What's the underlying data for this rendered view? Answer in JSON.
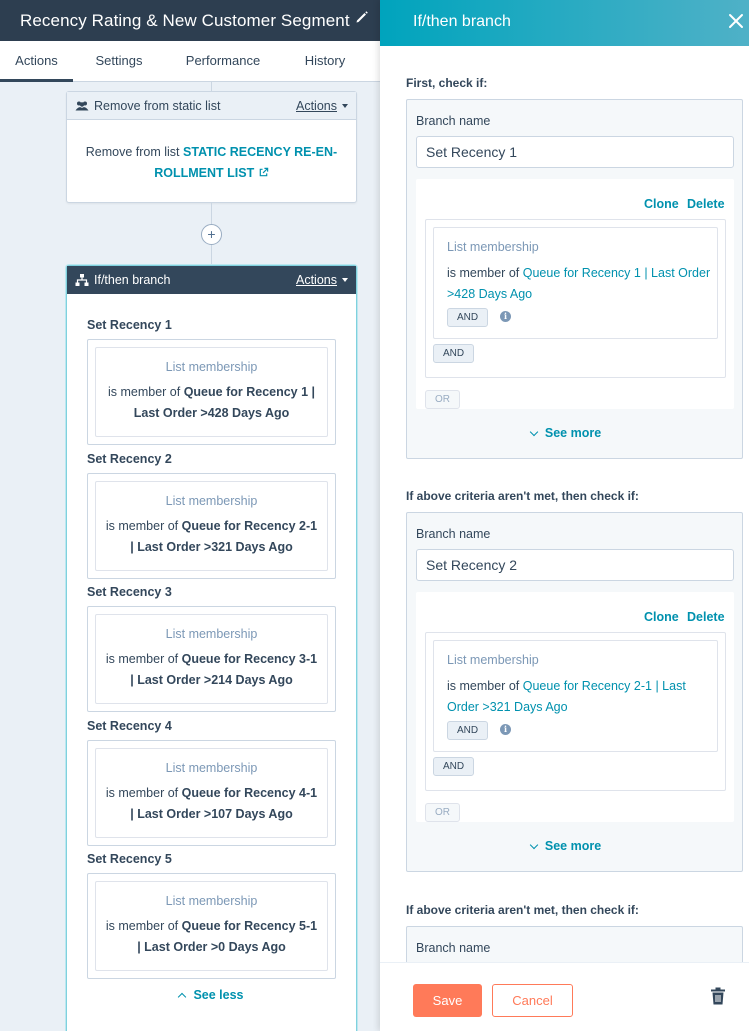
{
  "workflow": {
    "title": "Recency Rating & New Customer Segment",
    "tabs": [
      {
        "label": "Actions",
        "active": true
      },
      {
        "label": "Settings",
        "active": false
      },
      {
        "label": "Performance",
        "active": false
      },
      {
        "label": "History",
        "active": false
      }
    ]
  },
  "canvas": {
    "remove_card": {
      "title": "Remove from static list",
      "actions_label": "Actions",
      "body_prefix": "Remove from list",
      "list_name_line1": "STATIC RECENCY RE-EN-",
      "list_name_line2": "ROLLMENT LIST"
    },
    "plus_label": "+",
    "branch_card": {
      "title": "If/then branch",
      "actions_label": "Actions",
      "branches": [
        {
          "name": "Set Recency 1",
          "filter_type": "List membership",
          "prefix": "is member of",
          "list_a": "Queue for Recency 1 |",
          "list_b": "Last Order >428 Days Ago"
        },
        {
          "name": "Set Recency 2",
          "filter_type": "List membership",
          "prefix": "is member of",
          "list_a": "Queue for Recency 2-1",
          "list_b": "| Last Order >321 Days Ago"
        },
        {
          "name": "Set Recency 3",
          "filter_type": "List membership",
          "prefix": "is member of",
          "list_a": "Queue for Recency 3-1",
          "list_b": "| Last Order >214 Days Ago"
        },
        {
          "name": "Set Recency 4",
          "filter_type": "List membership",
          "prefix": "is member of",
          "list_a": "Queue for Recency 4-1",
          "list_b": "| Last Order >107 Days Ago"
        },
        {
          "name": "Set Recency 5",
          "filter_type": "List membership",
          "prefix": "is member of",
          "list_a": "Queue for Recency 5-1",
          "list_b": "| Last Order >0 Days Ago"
        }
      ],
      "see_less_label": "See less"
    }
  },
  "panel": {
    "title": "If/then branch",
    "sections": [
      {
        "heading": "First, check if:",
        "branch_label": "Branch name",
        "branch_value": "Set Recency 1",
        "clone_label": "Clone",
        "delete_label": "Delete",
        "filter_type": "List membership",
        "prefix": "is member of",
        "list_line1": "Queue for Recency 1 | Last Order",
        "list_line2": ">428 Days Ago",
        "and_inner": "AND",
        "and_outer": "AND",
        "or_label": "OR",
        "see_more_label": "See more"
      },
      {
        "heading": "If above criteria aren't met, then check if:",
        "branch_label": "Branch name",
        "branch_value": "Set Recency 2",
        "clone_label": "Clone",
        "delete_label": "Delete",
        "filter_type": "List membership",
        "prefix": "is member of",
        "list_line1": "Queue for Recency 2-1 | Last",
        "list_line2": "Order >321 Days Ago",
        "and_inner": "AND",
        "and_outer": "AND",
        "or_label": "OR",
        "see_more_label": "See more"
      },
      {
        "heading": "If above criteria aren't met, then check if:",
        "branch_label": "Branch name"
      }
    ],
    "save_label": "Save",
    "cancel_label": "Cancel"
  },
  "colors": {
    "header_dark": "#2d3e50",
    "teal": "#0091ae",
    "panel_header": "#00a4bd",
    "primary_orange": "#ff7a59",
    "text": "#33475b"
  }
}
